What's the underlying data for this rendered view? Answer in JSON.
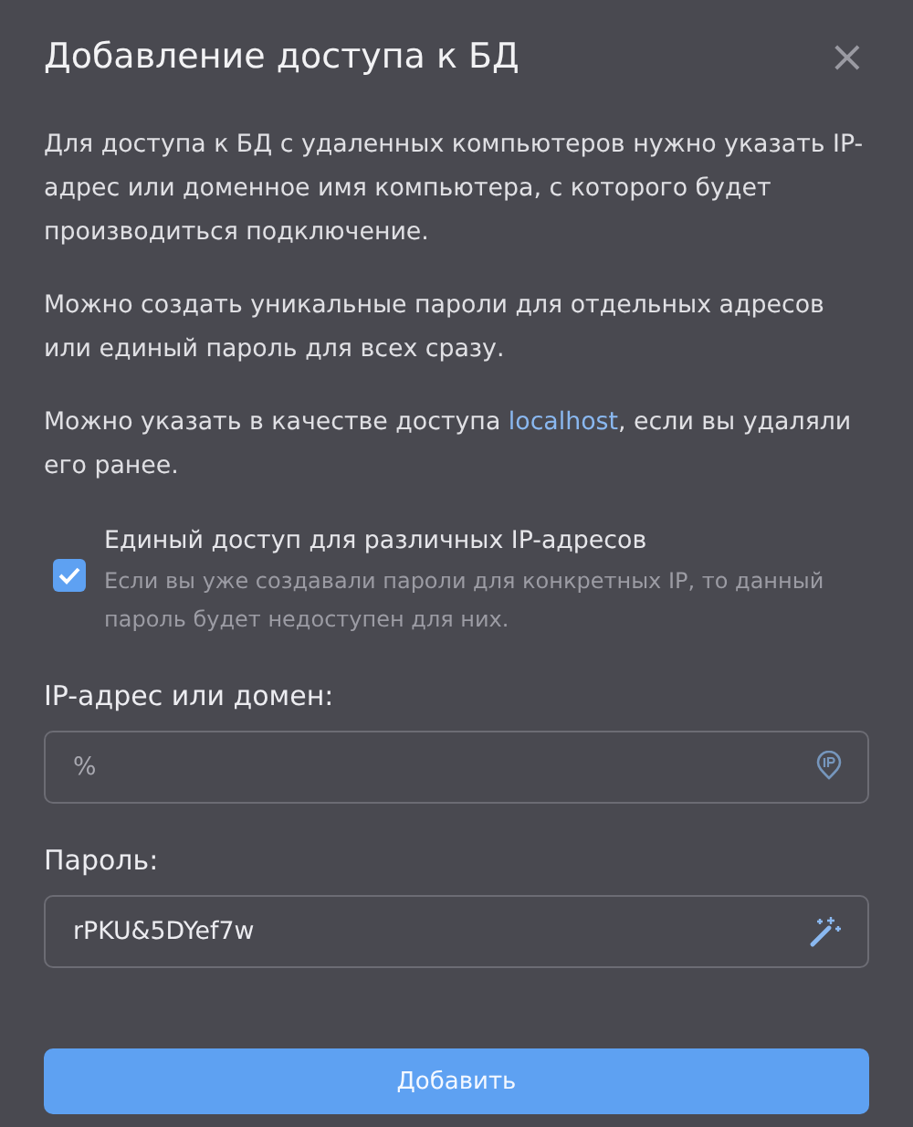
{
  "dialog": {
    "title": "Добавление доступа к БД",
    "close": "×"
  },
  "paragraphs": [
    {
      "text": "Для доступа к БД с удаленных компьютеров нужно указать IP-адрес или доменное имя компьютера, с которого будет производиться подключение."
    },
    {
      "text": "Можно создать уникальные пароли для отдельных адресов или единый пароль для всех сразу."
    },
    {
      "text": "Можно указать в качестве доступа ",
      "link": "localhost",
      "after": ", если вы удаляли его ранее."
    }
  ],
  "checkbox": {
    "label": "Единый доступ для различных IP-адресов",
    "hint": "Если вы уже создавали пароли для конкретных IP, то данный пароль будет недоступен для них.",
    "checked": true
  },
  "fields": [
    {
      "kind": "ip",
      "label": "IP-адрес или домен:",
      "placeholder": "%"
    },
    {
      "kind": "password",
      "label": "Пароль:",
      "value": "rPKU&5DYef7w"
    }
  ],
  "submit": "Добавить"
}
